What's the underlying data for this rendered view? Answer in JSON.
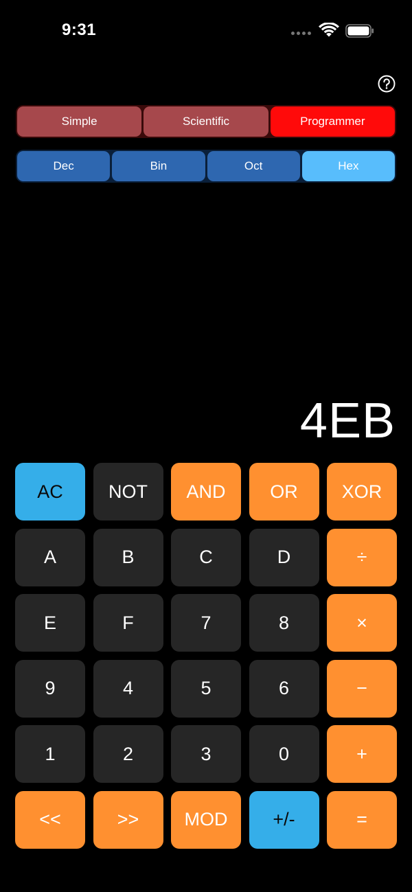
{
  "status_bar": {
    "time": "9:31"
  },
  "icons": {
    "help": "question-circle-icon",
    "wifi": "wifi-icon",
    "battery": "battery-icon",
    "signal": "cellular-signal-icon"
  },
  "modes": [
    {
      "label": "Simple",
      "active": false
    },
    {
      "label": "Scientific",
      "active": false
    },
    {
      "label": "Programmer",
      "active": true
    }
  ],
  "bases": [
    {
      "label": "Dec",
      "active": false
    },
    {
      "label": "Bin",
      "active": false
    },
    {
      "label": "Oct",
      "active": false
    },
    {
      "label": "Hex",
      "active": true
    }
  ],
  "display": {
    "value": "4EB"
  },
  "keys": [
    {
      "label": "AC",
      "style": "blue"
    },
    {
      "label": "NOT",
      "style": "dark"
    },
    {
      "label": "AND",
      "style": "orange"
    },
    {
      "label": "OR",
      "style": "orange"
    },
    {
      "label": "XOR",
      "style": "orange"
    },
    {
      "label": "A",
      "style": "dark"
    },
    {
      "label": "B",
      "style": "dark"
    },
    {
      "label": "C",
      "style": "dark"
    },
    {
      "label": "D",
      "style": "dark"
    },
    {
      "label": "÷",
      "style": "orange"
    },
    {
      "label": "E",
      "style": "dark"
    },
    {
      "label": "F",
      "style": "dark"
    },
    {
      "label": "7",
      "style": "dark"
    },
    {
      "label": "8",
      "style": "dark"
    },
    {
      "label": "×",
      "style": "orange"
    },
    {
      "label": "9",
      "style": "dark"
    },
    {
      "label": "4",
      "style": "dark"
    },
    {
      "label": "5",
      "style": "dark"
    },
    {
      "label": "6",
      "style": "dark"
    },
    {
      "label": "−",
      "style": "orange"
    },
    {
      "label": "1",
      "style": "dark"
    },
    {
      "label": "2",
      "style": "dark"
    },
    {
      "label": "3",
      "style": "dark"
    },
    {
      "label": "0",
      "style": "dark"
    },
    {
      "label": "+",
      "style": "orange"
    },
    {
      "label": "<<",
      "style": "orange"
    },
    {
      "label": ">>",
      "style": "orange"
    },
    {
      "label": "MOD",
      "style": "orange"
    },
    {
      "label": "+/-",
      "style": "blue"
    },
    {
      "label": "=",
      "style": "orange"
    }
  ],
  "colors": {
    "background": "#000000",
    "key_dark": "#262626",
    "key_orange": "#ff9030",
    "key_blue": "#35aee9",
    "mode_inactive": "#a6484c",
    "mode_active": "#ff0a0a",
    "base_inactive": "#2e67b0",
    "base_active": "#58bdfc"
  }
}
